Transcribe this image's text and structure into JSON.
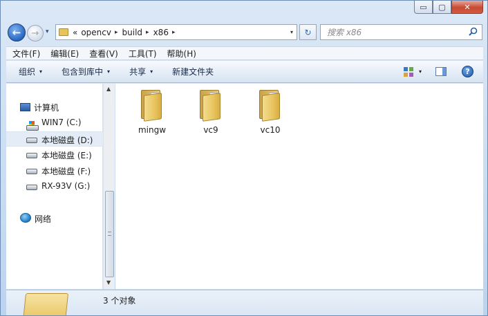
{
  "window": {
    "caption_buttons": {
      "minimize": "▭",
      "maximize": "▢",
      "close": "✕"
    }
  },
  "navigation": {
    "back_glyph": "←",
    "forward_glyph": "→",
    "history_glyph": "▾"
  },
  "address_bar": {
    "overflow": "«",
    "crumbs": [
      "opencv",
      "build",
      "x86"
    ],
    "separator": "▸",
    "dropdown_glyph": "▾"
  },
  "refresh_glyph": "↻",
  "search": {
    "placeholder": "搜索 x86",
    "icon": "search-icon"
  },
  "menu": {
    "items": [
      "文件(F)",
      "编辑(E)",
      "查看(V)",
      "工具(T)",
      "帮助(H)"
    ]
  },
  "command_bar": {
    "organize": "组织",
    "include_in_library": "包含到库中",
    "share": "共享",
    "new_folder": "新建文件夹",
    "caret": "▾",
    "help_glyph": "?"
  },
  "nav_tree": {
    "computer": "计算机",
    "drives": [
      {
        "label": "WIN7 (C:)",
        "icon": "windows-drive-icon"
      },
      {
        "label": "本地磁盘 (D:)",
        "icon": "drive-icon"
      },
      {
        "label": "本地磁盘 (E:)",
        "icon": "drive-icon"
      },
      {
        "label": "本地磁盘 (F:)",
        "icon": "drive-icon"
      },
      {
        "label": "RX-93V (G:)",
        "icon": "drive-icon"
      }
    ],
    "network": "网络",
    "selected_drive": "本地磁盘 (D:)"
  },
  "scrollbar": {
    "up": "▲",
    "down": "▼"
  },
  "folders": [
    {
      "name": "mingw"
    },
    {
      "name": "vc9"
    },
    {
      "name": "vc10"
    }
  ],
  "status": {
    "item_count": "3 个对象"
  }
}
